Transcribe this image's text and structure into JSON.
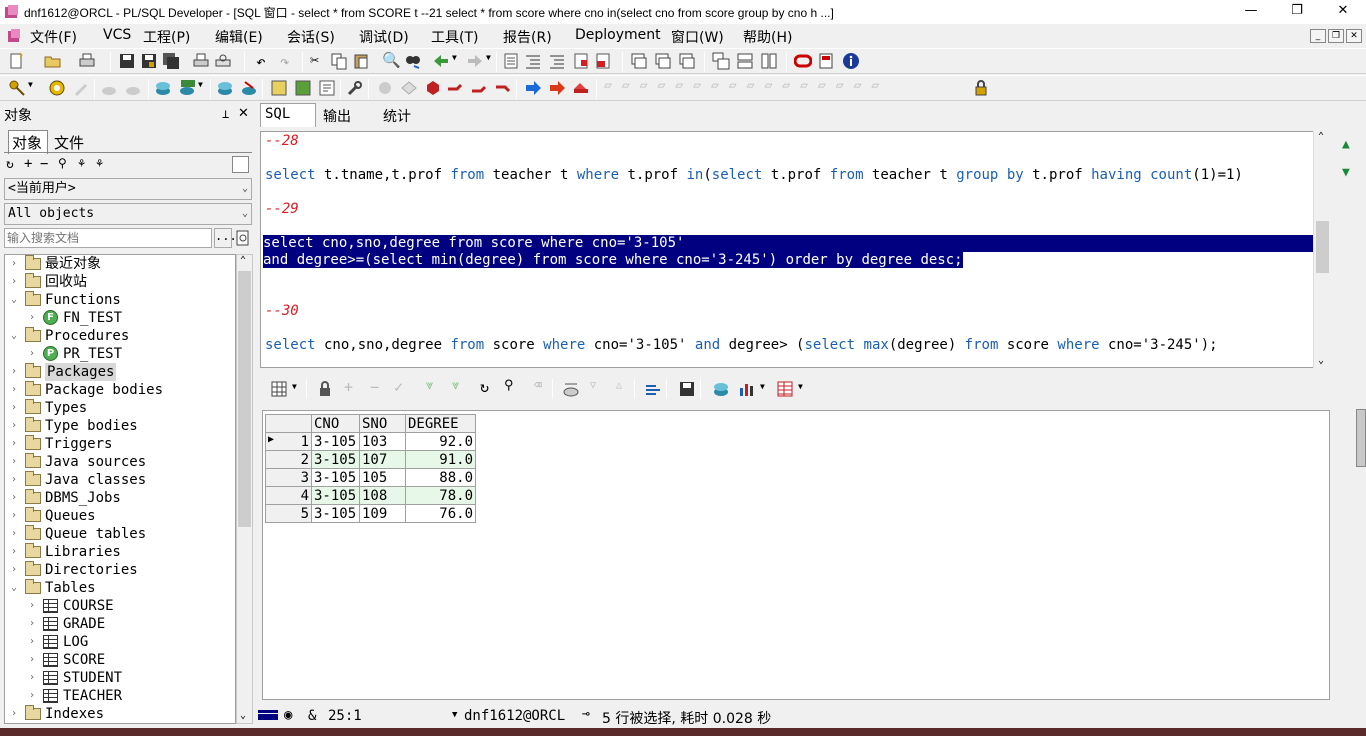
{
  "window": {
    "title": "dnf1612@ORCL - PL/SQL Developer - [SQL 窗口 - select * from SCORE t --21 select * from score where cno in(select cno from score group by cno h ...]",
    "min": "—",
    "max": "❐",
    "close": "✕"
  },
  "menu": [
    "文件(F)",
    "VCS",
    "工程(P)",
    "编辑(E)",
    "会话(S)",
    "调试(D)",
    "工具(T)",
    "报告(R)",
    "Deployment",
    "窗口(W)",
    "帮助(H)"
  ],
  "left": {
    "header": "对象",
    "pin": "📌",
    "close": "✕",
    "tabs": [
      "对象",
      "文件"
    ],
    "user_combo": "<当前用户>",
    "objects_combo": "All objects",
    "search_placeholder": "输入搜索文档",
    "search_btn": "...",
    "tree": [
      {
        "label": "最近对象",
        "icon": "folder",
        "exp": ">",
        "indent": 0
      },
      {
        "label": "回收站",
        "icon": "folder",
        "exp": ">",
        "indent": 0
      },
      {
        "label": "Functions",
        "icon": "folder",
        "exp": "v",
        "indent": 0
      },
      {
        "label": "FN_TEST",
        "icon": "function",
        "exp": ">",
        "indent": 1
      },
      {
        "label": "Procedures",
        "icon": "folder",
        "exp": "v",
        "indent": 0
      },
      {
        "label": "PR_TEST",
        "icon": "procedure",
        "exp": ">",
        "indent": 1
      },
      {
        "label": "Packages",
        "icon": "folder",
        "exp": ">",
        "indent": 0,
        "selected": true
      },
      {
        "label": "Package bodies",
        "icon": "folder",
        "exp": ">",
        "indent": 0
      },
      {
        "label": "Types",
        "icon": "folder",
        "exp": ">",
        "indent": 0
      },
      {
        "label": "Type bodies",
        "icon": "folder",
        "exp": ">",
        "indent": 0
      },
      {
        "label": "Triggers",
        "icon": "folder",
        "exp": ">",
        "indent": 0
      },
      {
        "label": "Java sources",
        "icon": "folder",
        "exp": ">",
        "indent": 0
      },
      {
        "label": "Java classes",
        "icon": "folder",
        "exp": ">",
        "indent": 0
      },
      {
        "label": "DBMS_Jobs",
        "icon": "folder",
        "exp": ">",
        "indent": 0
      },
      {
        "label": "Queues",
        "icon": "folder",
        "exp": ">",
        "indent": 0
      },
      {
        "label": "Queue tables",
        "icon": "folder",
        "exp": ">",
        "indent": 0
      },
      {
        "label": "Libraries",
        "icon": "folder",
        "exp": ">",
        "indent": 0
      },
      {
        "label": "Directories",
        "icon": "folder",
        "exp": ">",
        "indent": 0
      },
      {
        "label": "Tables",
        "icon": "folder",
        "exp": "v",
        "indent": 0
      },
      {
        "label": "COURSE",
        "icon": "table",
        "exp": ">",
        "indent": 1
      },
      {
        "label": "GRADE",
        "icon": "table",
        "exp": ">",
        "indent": 1
      },
      {
        "label": "LOG",
        "icon": "table",
        "exp": ">",
        "indent": 1
      },
      {
        "label": "SCORE",
        "icon": "table",
        "exp": ">",
        "indent": 1
      },
      {
        "label": "STUDENT",
        "icon": "table",
        "exp": ">",
        "indent": 1
      },
      {
        "label": "TEACHER",
        "icon": "table",
        "exp": ">",
        "indent": 1
      },
      {
        "label": "Indexes",
        "icon": "folder",
        "exp": ">",
        "indent": 0
      }
    ]
  },
  "editor": {
    "tabs": [
      "SQL",
      "输出",
      "统计"
    ],
    "lines": [
      {
        "c": "--28"
      },
      {
        "sql": "select t.tname,t.prof from teacher t where t.prof in(select t.prof from teacher t group by t.prof having count(1)=1)"
      },
      {
        "c": "--29"
      },
      {
        "sel": "select cno,sno,degree from score where cno='3-105'"
      },
      {
        "sel": "and degree>=(select min(degree) from score where cno='3-245') order by degree desc;"
      },
      {
        "c": "--30"
      },
      {
        "sql": "select cno,sno,degree from score where cno='3-105' and degree> (select max(degree) from score where cno='3-245');"
      }
    ]
  },
  "grid": {
    "columns": [
      "CNO",
      "SNO",
      "DEGREE"
    ],
    "rows": [
      [
        "1",
        "3-105",
        "103",
        "92.0"
      ],
      [
        "2",
        "3-105",
        "107",
        "91.0"
      ],
      [
        "3",
        "3-105",
        "105",
        "88.0"
      ],
      [
        "4",
        "3-105",
        "108",
        "78.0"
      ],
      [
        "5",
        "3-105",
        "109",
        "76.0"
      ]
    ]
  },
  "status": {
    "position": "25:1",
    "connection": "dnf1612@ORCL",
    "message": "5 行被选择, 耗时 0.028 秒",
    "amp": "&"
  }
}
